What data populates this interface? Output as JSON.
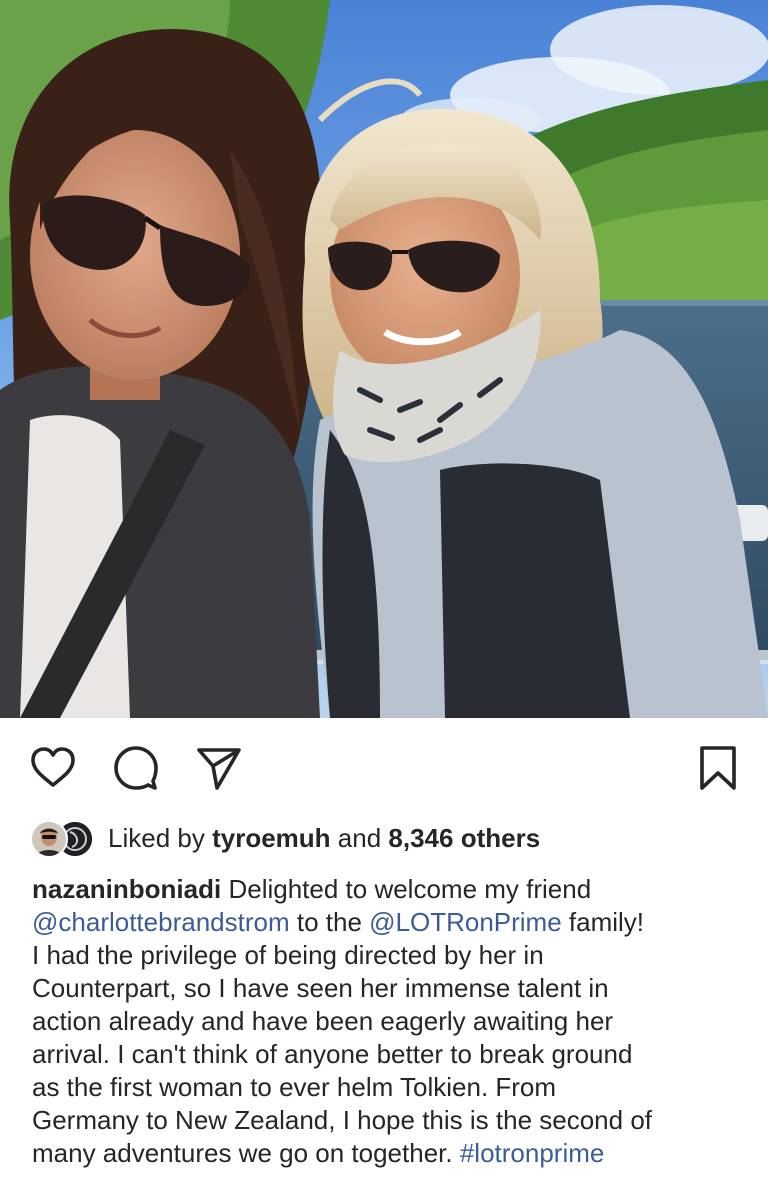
{
  "post": {
    "photo_alt_icon": "photo-two-women-selfie",
    "actions": {
      "like_icon": "heart-icon",
      "comment_icon": "comment-icon",
      "share_icon": "paper-plane-icon",
      "save_icon": "bookmark-icon"
    },
    "likes": {
      "prefix": "Liked by",
      "user": "tyroemuh",
      "joiner": "and",
      "count": "8,346 others"
    },
    "caption": {
      "username": "nazaninboniadi",
      "line1_text": " Delighted to welcome my friend",
      "line2_mention": "@charlottebrandstrom",
      "line2_mid": " to the ",
      "line2_mention2": "@LOTRonPrime",
      "line2_tail": " family!",
      "line3": "I had the privilege of being directed by her in",
      "line4": "Counterpart, so I have seen her immense talent in",
      "line5": "action already and have been eagerly awaiting her",
      "line6": "arrival. I can't think of anyone better to break ground",
      "line7": "as the first woman to ever helm Tolkien. From",
      "line8": "Germany to New Zealand, I hope this is the second of",
      "line9_text": "many adventures we go on together. ",
      "line9_hashtag": "#lotronprime"
    }
  },
  "colors": {
    "link": "#3b5c99",
    "text": "#262626"
  }
}
